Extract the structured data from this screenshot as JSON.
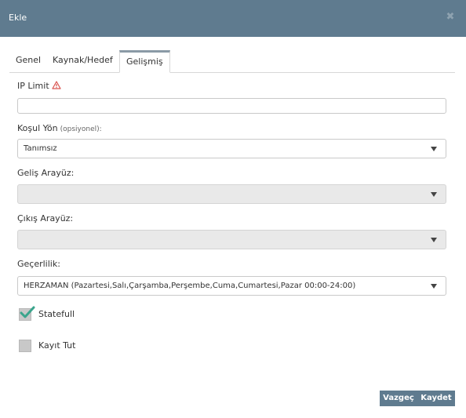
{
  "dialog": {
    "title": "Ekle",
    "close_icon": "close-icon"
  },
  "tabs": [
    {
      "label": "Genel",
      "active": false
    },
    {
      "label": "Kaynak/Hedef",
      "active": false
    },
    {
      "label": "Gelişmiş",
      "active": true
    }
  ],
  "fields": {
    "ip_limit": {
      "label": "IP Limit",
      "icon": "warning-icon",
      "value": ""
    },
    "kosul_yon": {
      "label": "Koşul Yön",
      "sublabel": "(opsiyonel):",
      "value": "Tanımsız"
    },
    "gelis_arayuz": {
      "label": "Geliş Arayüz:",
      "value": "",
      "disabled": true
    },
    "cikis_arayuz": {
      "label": "Çıkış Arayüz:",
      "value": "",
      "disabled": true
    },
    "gecerlilik": {
      "label": "Geçerlilik:",
      "value": "HERZAMAN (Pazartesi,Salı,Çarşamba,Perşembe,Cuma,Cumartesi,Pazar 00:00-24:00)"
    }
  },
  "checkboxes": {
    "statefull": {
      "label": "Statefull",
      "checked": true
    },
    "kayit_tut": {
      "label": "Kayıt Tut",
      "checked": false
    }
  },
  "buttons": {
    "cancel": "Vazgeç",
    "save": "Kaydet"
  },
  "colors": {
    "titlebar": "#5f7b8f",
    "check": "#3aa58c",
    "warning": "#d9534f"
  }
}
